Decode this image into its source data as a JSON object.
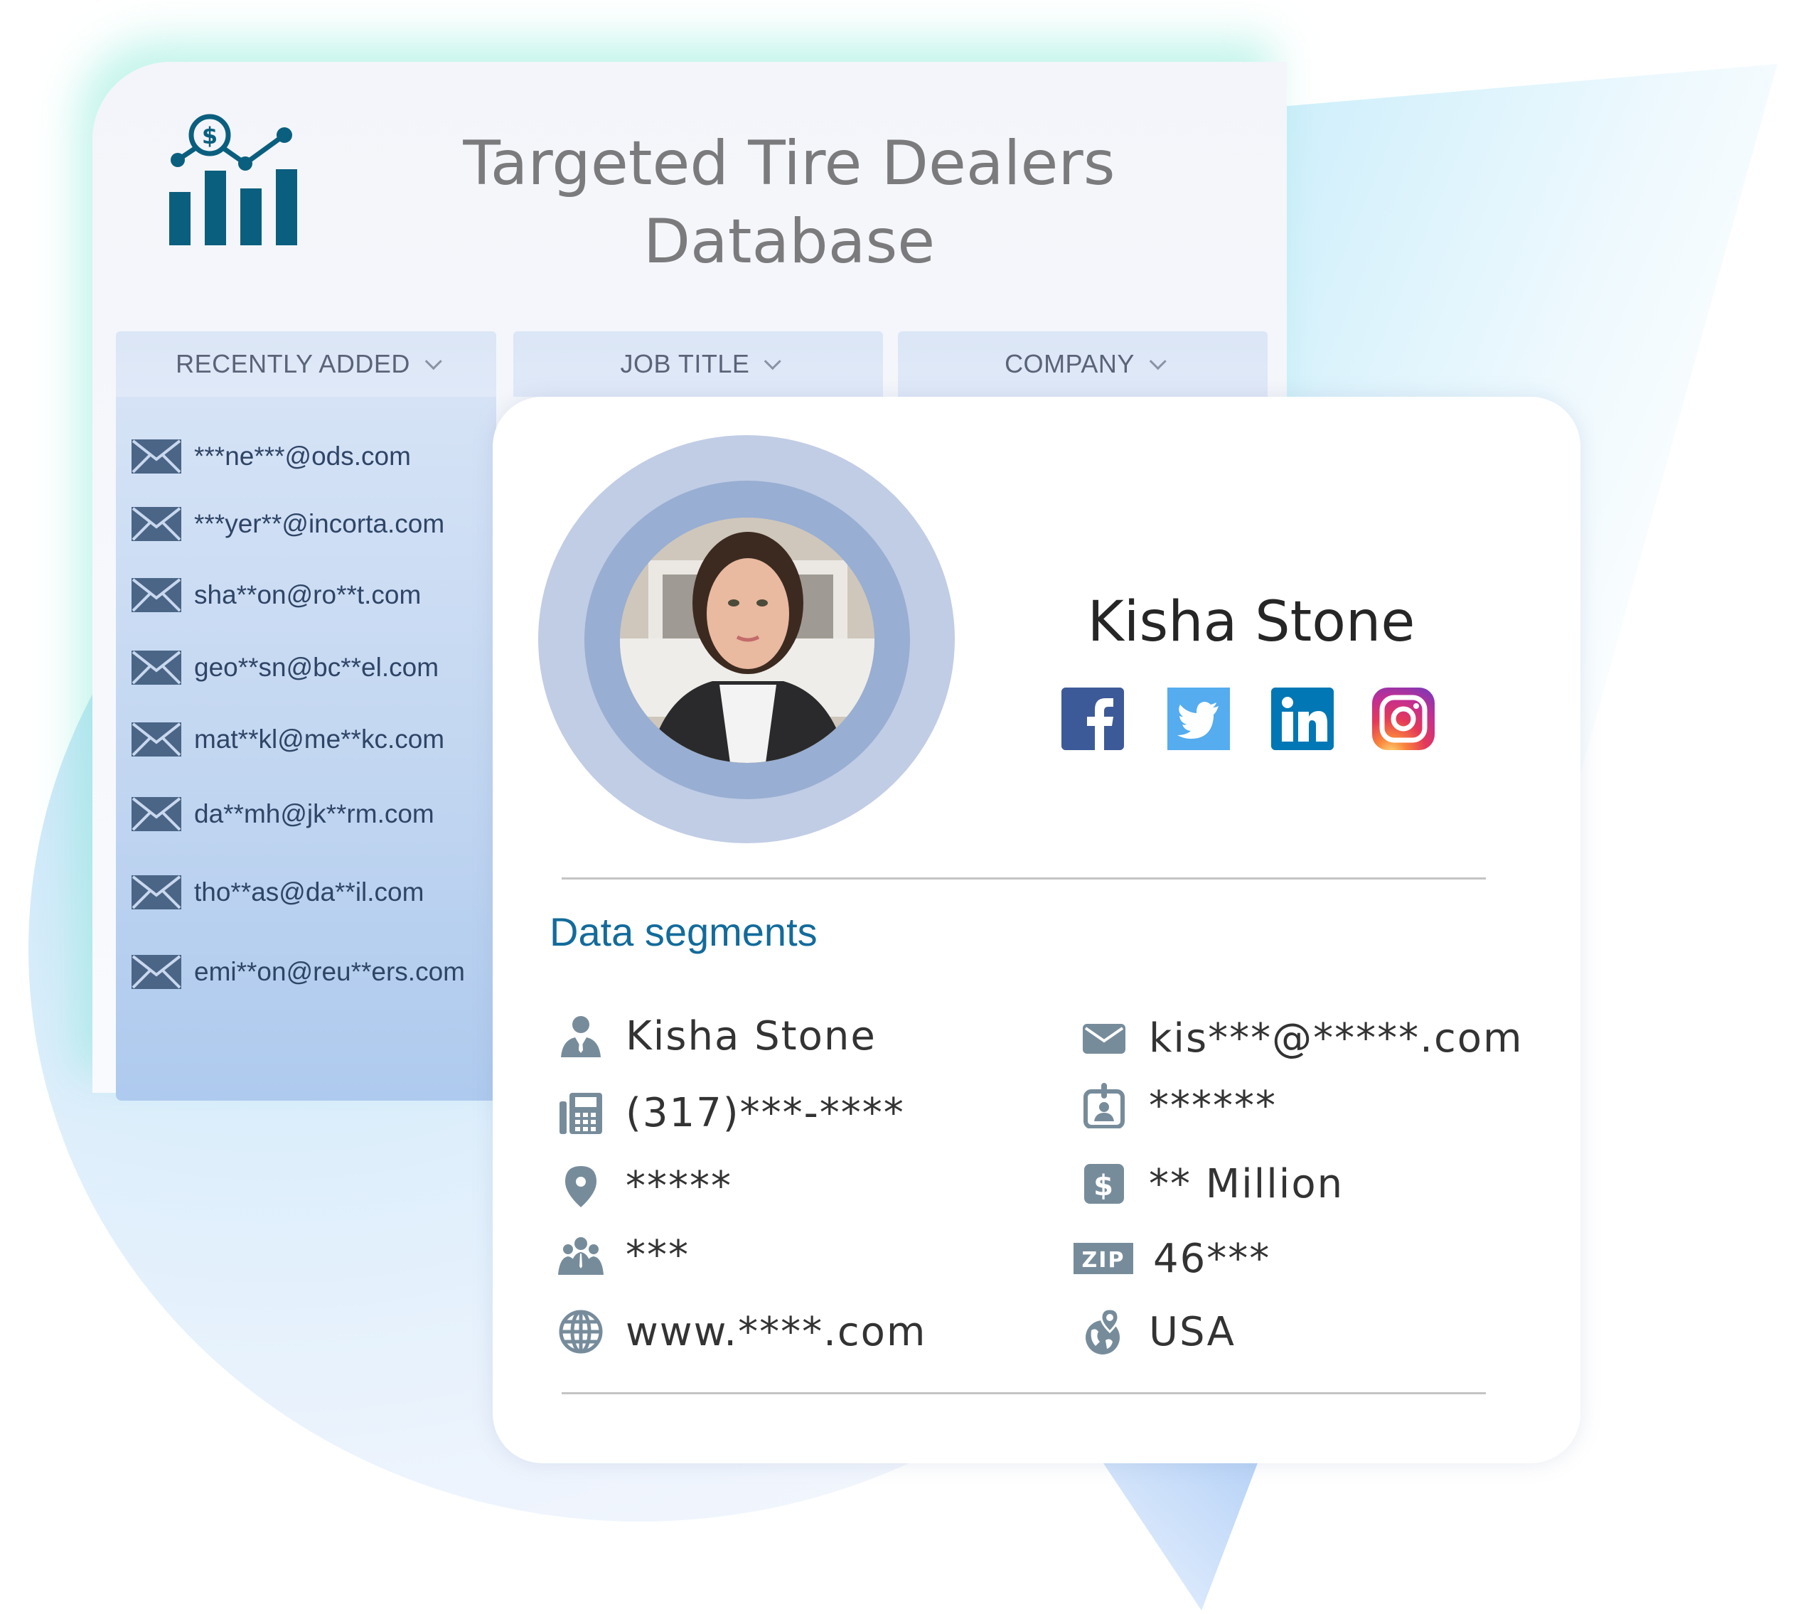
{
  "header": {
    "title_line1": "Targeted Tire Dealers",
    "title_line2": "Database",
    "logo_icon": "chart-dollar-icon"
  },
  "tabs": [
    {
      "label": "RECENTLY ADDED",
      "icon": "chevron-down-icon"
    },
    {
      "label": "JOB TITLE",
      "icon": "chevron-down-icon"
    },
    {
      "label": "COMPANY",
      "icon": "chevron-down-icon"
    }
  ],
  "recent_list": {
    "icon": "envelope-icon",
    "items": [
      "***ne***@ods.com",
      "***yer**@incorta.com",
      "sha**on@ro**t.com",
      "geo**sn@bc**el.com",
      "mat**kl@me**kc.com",
      "da**mh@jk**rm.com",
      "tho**as@da**il.com",
      "emi**on@reu**ers.com"
    ]
  },
  "profile": {
    "name": "Kisha Stone",
    "social": [
      "facebook",
      "twitter",
      "linkedin",
      "instagram"
    ],
    "colors": {
      "facebook": "#3d5a98",
      "twitter": "#55acee",
      "linkedin": "#0177b5",
      "accent": "#136b9b"
    }
  },
  "segments": {
    "title": "Data segments",
    "left": [
      {
        "icon": "person-icon",
        "value": "Kisha Stone"
      },
      {
        "icon": "phone-icon",
        "value": "(317)***-****"
      },
      {
        "icon": "location-pin-icon",
        "value": "*****"
      },
      {
        "icon": "group-icon",
        "value": "***"
      },
      {
        "icon": "globe-icon",
        "value": "www.****.com"
      }
    ],
    "right": [
      {
        "icon": "envelope-icon",
        "value": "kis***@*****.com"
      },
      {
        "icon": "id-badge-icon",
        "value": "******"
      },
      {
        "icon": "dollar-icon",
        "value": "** Million"
      },
      {
        "icon": "zip-icon",
        "value": "46***"
      },
      {
        "icon": "globe-pin-icon",
        "value": "USA"
      }
    ]
  }
}
